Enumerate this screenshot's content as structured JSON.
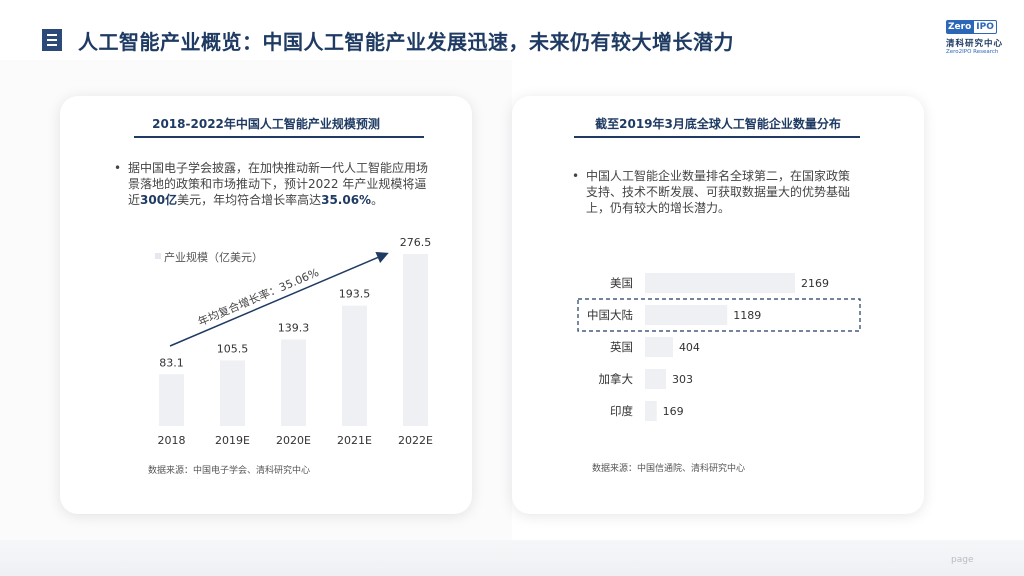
{
  "header": {
    "title": "人工智能产业概览：中国人工智能产业发展迅速，未来仍有较大增长潜力",
    "logo": {
      "zero": "Zero",
      "ipo": "IPO",
      "cn": "清科研究中心",
      "en": "Zero2IPO Research"
    }
  },
  "left_panel": {
    "title": "2018-2022年中国人工智能产业规模预测",
    "bullet_marker": "•",
    "bullet_pre": "据中国电子学会披露，在加快推动新一代人工智能应用场景落地的政策和市场推动下，预计2022 年产业规模将逼近",
    "bullet_highlight1": "300亿",
    "bullet_mid": "美元，年均符合增长率高达",
    "bullet_highlight2": "35.06%",
    "bullet_post": "。",
    "legend": "产业规模（亿美元）",
    "growth_label": "年均复合增长率：35.06%",
    "source": "数据来源：中国电子学会、清科研究中心"
  },
  "right_panel": {
    "title": "截至2019年3月底全球人工智能企业数量分布",
    "bullet_marker": "•",
    "bullet": "中国人工智能企业数量排名全球第二，在国家政策支持、技术不断发展、可获取数据量大的优势基础上，仍有较大的增长潜力。",
    "source": "数据来源：中国信通院、清科研究中心"
  },
  "chart_data": [
    {
      "type": "bar",
      "title": "2018-2022年中国人工智能产业规模预测",
      "categories": [
        "2018",
        "2019E",
        "2020E",
        "2021E",
        "2022E"
      ],
      "series": [
        {
          "name": "产业规模（亿美元）",
          "values": [
            83.1,
            105.5,
            139.3,
            193.5,
            276.5
          ]
        }
      ],
      "annotation": "年均复合增长率：35.06%",
      "color": "#eef0f4"
    },
    {
      "type": "bar",
      "orientation": "horizontal",
      "title": "截至2019年3月底全球人工智能企业数量分布",
      "categories": [
        "美国",
        "中国大陆",
        "英国",
        "加拿大",
        "印度"
      ],
      "values": [
        2169,
        1189,
        404,
        303,
        169
      ],
      "highlight": "中国大陆",
      "color": "#eef0f4",
      "highlight_color": "#1f3b63"
    }
  ],
  "footer": {
    "page_label": "page"
  }
}
